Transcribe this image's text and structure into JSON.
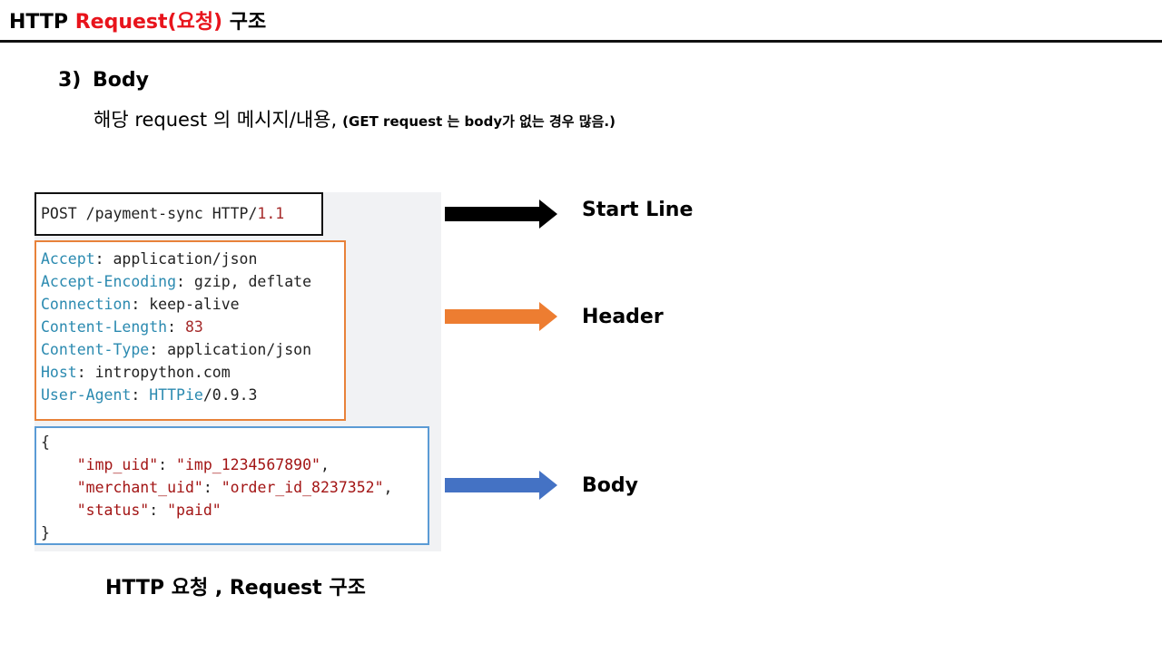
{
  "title": {
    "prefix": "HTTP ",
    "accent": "Request(요청)",
    "suffix": " 구조"
  },
  "section": {
    "number": "3)",
    "heading": "Body",
    "description": "해당 request 의 메시지/내용,",
    "note": "(GET request 는 body가 없는 경우 많음.)"
  },
  "code": {
    "start_line": {
      "text": "POST /payment-sync HTTP/",
      "version": "1.1"
    },
    "headers": [
      {
        "key": "Accept",
        "sep": ": ",
        "value": "application/json"
      },
      {
        "key": "Accept-Encoding",
        "sep": ": ",
        "value": "gzip, deflate"
      },
      {
        "key": "Connection",
        "sep": ": ",
        "value": "keep-alive"
      },
      {
        "key": "Content-Length",
        "sep": ": ",
        "value": "83"
      },
      {
        "key": "Content-Type",
        "sep": ": ",
        "value": "application/json"
      },
      {
        "key": "Host",
        "sep": ": ",
        "value": "intropython.com"
      },
      {
        "key": "User-Agent",
        "sep": ": ",
        "value_product": "HTTPie",
        "value_version": "/0.9.3"
      }
    ],
    "body": {
      "open": "{",
      "fields": [
        {
          "key": "\"imp_uid\"",
          "value": "\"imp_1234567890\"",
          "trail": ","
        },
        {
          "key": "\"merchant_uid\"",
          "value": "\"order_id_8237352\"",
          "trail": ","
        },
        {
          "key": "\"status\"",
          "value": "\"paid\"",
          "trail": ""
        }
      ],
      "close": "}"
    }
  },
  "labels": {
    "start_line": "Start Line",
    "header": "Header",
    "body": "Body"
  },
  "caption": "HTTP 요청 , Request 구조",
  "colors": {
    "accent": "#e8141c",
    "start_line": "#000000",
    "header": "#ed7d31",
    "body": "#4472c4",
    "header_key": "#2b8ab0",
    "string": "#a31515"
  }
}
